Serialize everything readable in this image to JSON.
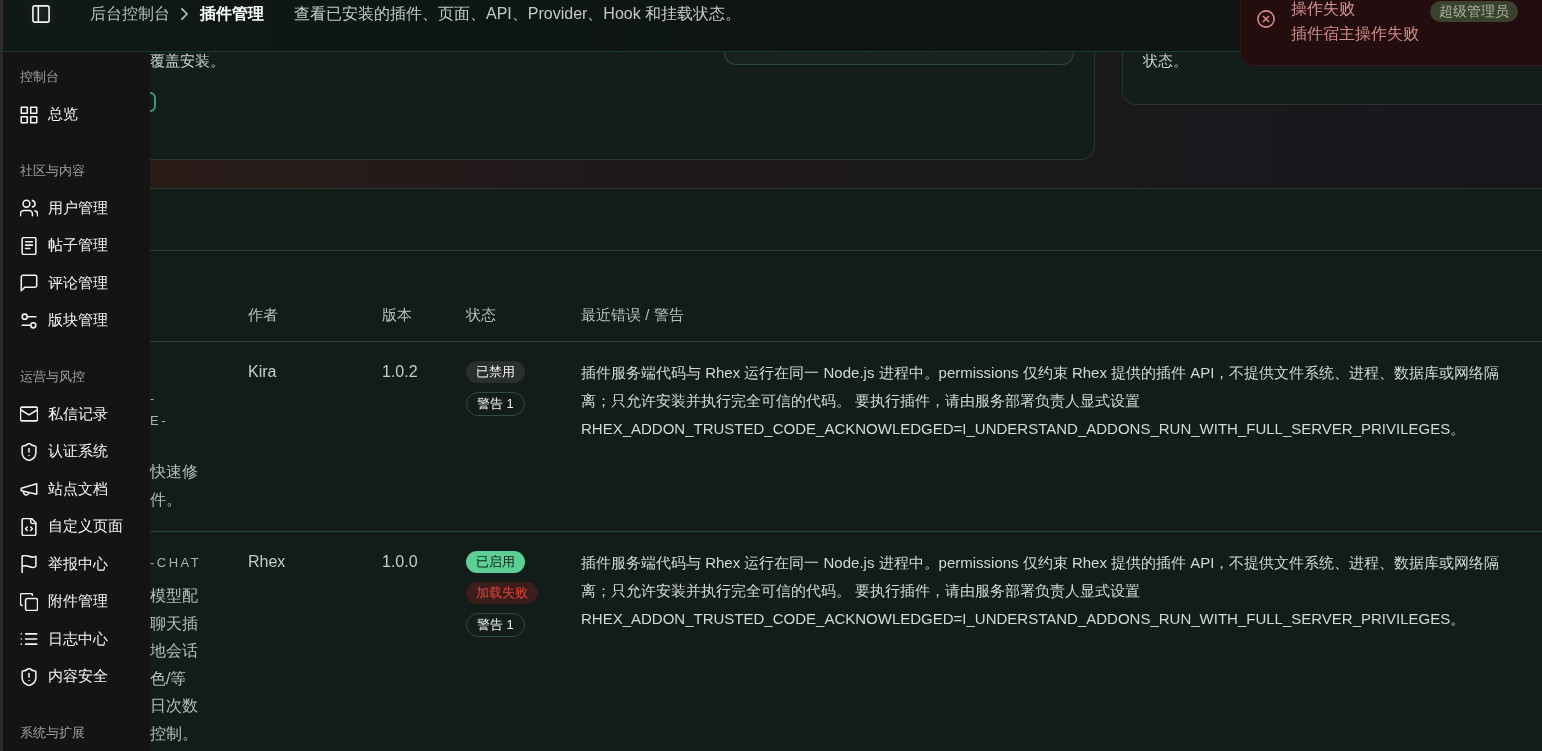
{
  "header": {
    "breadcrumb": [
      {
        "label": "后台控制台",
        "current": false
      },
      {
        "label": "插件管理",
        "current": true
      }
    ],
    "description": "查看已安装的插件、页面、API、Provider、Hook 和挂载状态。",
    "role_badge": "超级管理员"
  },
  "toast": {
    "kind": "error",
    "title": "操作失败",
    "message": "插件宿主操作失败"
  },
  "sidebar": {
    "sections": [
      {
        "label": "控制台",
        "items": [
          {
            "label": "总览",
            "selected": false
          }
        ]
      },
      {
        "label": "社区与内容",
        "items": [
          {
            "label": "用户管理",
            "selected": false
          },
          {
            "label": "帖子管理",
            "selected": false
          },
          {
            "label": "评论管理",
            "selected": false
          },
          {
            "label": "版块管理",
            "selected": false
          }
        ]
      },
      {
        "label": "运营与风控",
        "items": [
          {
            "label": "私信记录",
            "selected": false
          },
          {
            "label": "认证系统",
            "selected": false
          },
          {
            "label": "站点文档",
            "selected": false
          },
          {
            "label": "自定义页面",
            "selected": false
          },
          {
            "label": "举报中心",
            "selected": false
          },
          {
            "label": "附件管理",
            "selected": false
          },
          {
            "label": "日志中心",
            "selected": false
          },
          {
            "label": "内容安全",
            "selected": false
          }
        ]
      },
      {
        "label": "系统与扩展"
      }
    ]
  },
  "summary_cards": [
    {
      "text": "覆盖安装。"
    },
    {
      "text": "状态。"
    }
  ],
  "plugins_table": {
    "columns": [
      "作者",
      "版本",
      "状态",
      "最近错误 / 警告"
    ],
    "rows": [
      {
        "slug_lines": [
          "-",
          "E-"
        ],
        "description_lines": [
          "快速修",
          "件。"
        ],
        "author": "Kira",
        "version": "1.0.2",
        "badges": [
          {
            "kind": "disabled",
            "label": "已禁用"
          },
          {
            "kind": "warning",
            "label": "警告 1"
          }
        ],
        "message": "插件服务端代码与 Rhex 运行在同一 Node.js 进程中。permissions 仅约束 Rhex 提供的插件 API，不提供文件系统、进程、数据库或网络隔离；只允许安装并执行完全可信的代码。 要执行插件，请由服务部署负责人显式设置 RHEX_ADDON_TRUSTED_CODE_ACKNOWLEDGED=I_UNDERSTAND_ADDONS_RUN_WITH_FULL_SERVER_PRIVILEGES。"
      },
      {
        "slug_lines": [
          "-CHAT"
        ],
        "description_lines": [
          "模型配",
          "聊天插",
          "地会话",
          "色/等",
          "日次数",
          "控制。"
        ],
        "author": "Rhex",
        "version": "1.0.0",
        "badges": [
          {
            "kind": "enabled",
            "label": "已启用"
          },
          {
            "kind": "load_error",
            "label": "加载失败"
          },
          {
            "kind": "warning",
            "label": "警告 1"
          }
        ],
        "message": "插件服务端代码与 Rhex 运行在同一 Node.js 进程中。permissions 仅约束 Rhex 提供的插件 API，不提供文件系统、进程、数据库或网络隔离；只允许安装并执行完全可信的代码。 要执行插件，请由服务部署负责人显式设置 RHEX_ADDON_TRUSTED_CODE_ACKNOWLEDGED=I_UNDERSTAND_ADDONS_RUN_WITH_FULL_SERVER_PRIVILEGES。"
      }
    ]
  }
}
